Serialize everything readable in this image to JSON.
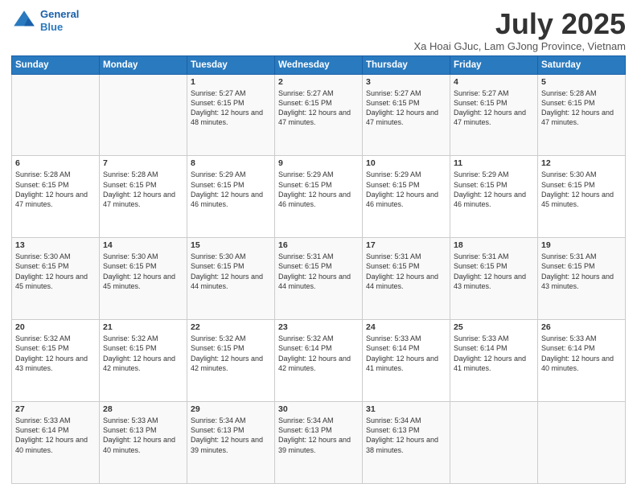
{
  "logo": {
    "line1": "General",
    "line2": "Blue"
  },
  "title": {
    "month_year": "July 2025",
    "location": "Xa Hoai GJuc, Lam GJong Province, Vietnam"
  },
  "weekdays": [
    "Sunday",
    "Monday",
    "Tuesday",
    "Wednesday",
    "Thursday",
    "Friday",
    "Saturday"
  ],
  "weeks": [
    [
      {
        "day": "",
        "info": ""
      },
      {
        "day": "",
        "info": ""
      },
      {
        "day": "1",
        "info": "Sunrise: 5:27 AM\nSunset: 6:15 PM\nDaylight: 12 hours and 48 minutes."
      },
      {
        "day": "2",
        "info": "Sunrise: 5:27 AM\nSunset: 6:15 PM\nDaylight: 12 hours and 47 minutes."
      },
      {
        "day": "3",
        "info": "Sunrise: 5:27 AM\nSunset: 6:15 PM\nDaylight: 12 hours and 47 minutes."
      },
      {
        "day": "4",
        "info": "Sunrise: 5:27 AM\nSunset: 6:15 PM\nDaylight: 12 hours and 47 minutes."
      },
      {
        "day": "5",
        "info": "Sunrise: 5:28 AM\nSunset: 6:15 PM\nDaylight: 12 hours and 47 minutes."
      }
    ],
    [
      {
        "day": "6",
        "info": "Sunrise: 5:28 AM\nSunset: 6:15 PM\nDaylight: 12 hours and 47 minutes."
      },
      {
        "day": "7",
        "info": "Sunrise: 5:28 AM\nSunset: 6:15 PM\nDaylight: 12 hours and 47 minutes."
      },
      {
        "day": "8",
        "info": "Sunrise: 5:29 AM\nSunset: 6:15 PM\nDaylight: 12 hours and 46 minutes."
      },
      {
        "day": "9",
        "info": "Sunrise: 5:29 AM\nSunset: 6:15 PM\nDaylight: 12 hours and 46 minutes."
      },
      {
        "day": "10",
        "info": "Sunrise: 5:29 AM\nSunset: 6:15 PM\nDaylight: 12 hours and 46 minutes."
      },
      {
        "day": "11",
        "info": "Sunrise: 5:29 AM\nSunset: 6:15 PM\nDaylight: 12 hours and 46 minutes."
      },
      {
        "day": "12",
        "info": "Sunrise: 5:30 AM\nSunset: 6:15 PM\nDaylight: 12 hours and 45 minutes."
      }
    ],
    [
      {
        "day": "13",
        "info": "Sunrise: 5:30 AM\nSunset: 6:15 PM\nDaylight: 12 hours and 45 minutes."
      },
      {
        "day": "14",
        "info": "Sunrise: 5:30 AM\nSunset: 6:15 PM\nDaylight: 12 hours and 45 minutes."
      },
      {
        "day": "15",
        "info": "Sunrise: 5:30 AM\nSunset: 6:15 PM\nDaylight: 12 hours and 44 minutes."
      },
      {
        "day": "16",
        "info": "Sunrise: 5:31 AM\nSunset: 6:15 PM\nDaylight: 12 hours and 44 minutes."
      },
      {
        "day": "17",
        "info": "Sunrise: 5:31 AM\nSunset: 6:15 PM\nDaylight: 12 hours and 44 minutes."
      },
      {
        "day": "18",
        "info": "Sunrise: 5:31 AM\nSunset: 6:15 PM\nDaylight: 12 hours and 43 minutes."
      },
      {
        "day": "19",
        "info": "Sunrise: 5:31 AM\nSunset: 6:15 PM\nDaylight: 12 hours and 43 minutes."
      }
    ],
    [
      {
        "day": "20",
        "info": "Sunrise: 5:32 AM\nSunset: 6:15 PM\nDaylight: 12 hours and 43 minutes."
      },
      {
        "day": "21",
        "info": "Sunrise: 5:32 AM\nSunset: 6:15 PM\nDaylight: 12 hours and 42 minutes."
      },
      {
        "day": "22",
        "info": "Sunrise: 5:32 AM\nSunset: 6:15 PM\nDaylight: 12 hours and 42 minutes."
      },
      {
        "day": "23",
        "info": "Sunrise: 5:32 AM\nSunset: 6:14 PM\nDaylight: 12 hours and 42 minutes."
      },
      {
        "day": "24",
        "info": "Sunrise: 5:33 AM\nSunset: 6:14 PM\nDaylight: 12 hours and 41 minutes."
      },
      {
        "day": "25",
        "info": "Sunrise: 5:33 AM\nSunset: 6:14 PM\nDaylight: 12 hours and 41 minutes."
      },
      {
        "day": "26",
        "info": "Sunrise: 5:33 AM\nSunset: 6:14 PM\nDaylight: 12 hours and 40 minutes."
      }
    ],
    [
      {
        "day": "27",
        "info": "Sunrise: 5:33 AM\nSunset: 6:14 PM\nDaylight: 12 hours and 40 minutes."
      },
      {
        "day": "28",
        "info": "Sunrise: 5:33 AM\nSunset: 6:13 PM\nDaylight: 12 hours and 40 minutes."
      },
      {
        "day": "29",
        "info": "Sunrise: 5:34 AM\nSunset: 6:13 PM\nDaylight: 12 hours and 39 minutes."
      },
      {
        "day": "30",
        "info": "Sunrise: 5:34 AM\nSunset: 6:13 PM\nDaylight: 12 hours and 39 minutes."
      },
      {
        "day": "31",
        "info": "Sunrise: 5:34 AM\nSunset: 6:13 PM\nDaylight: 12 hours and 38 minutes."
      },
      {
        "day": "",
        "info": ""
      },
      {
        "day": "",
        "info": ""
      }
    ]
  ]
}
